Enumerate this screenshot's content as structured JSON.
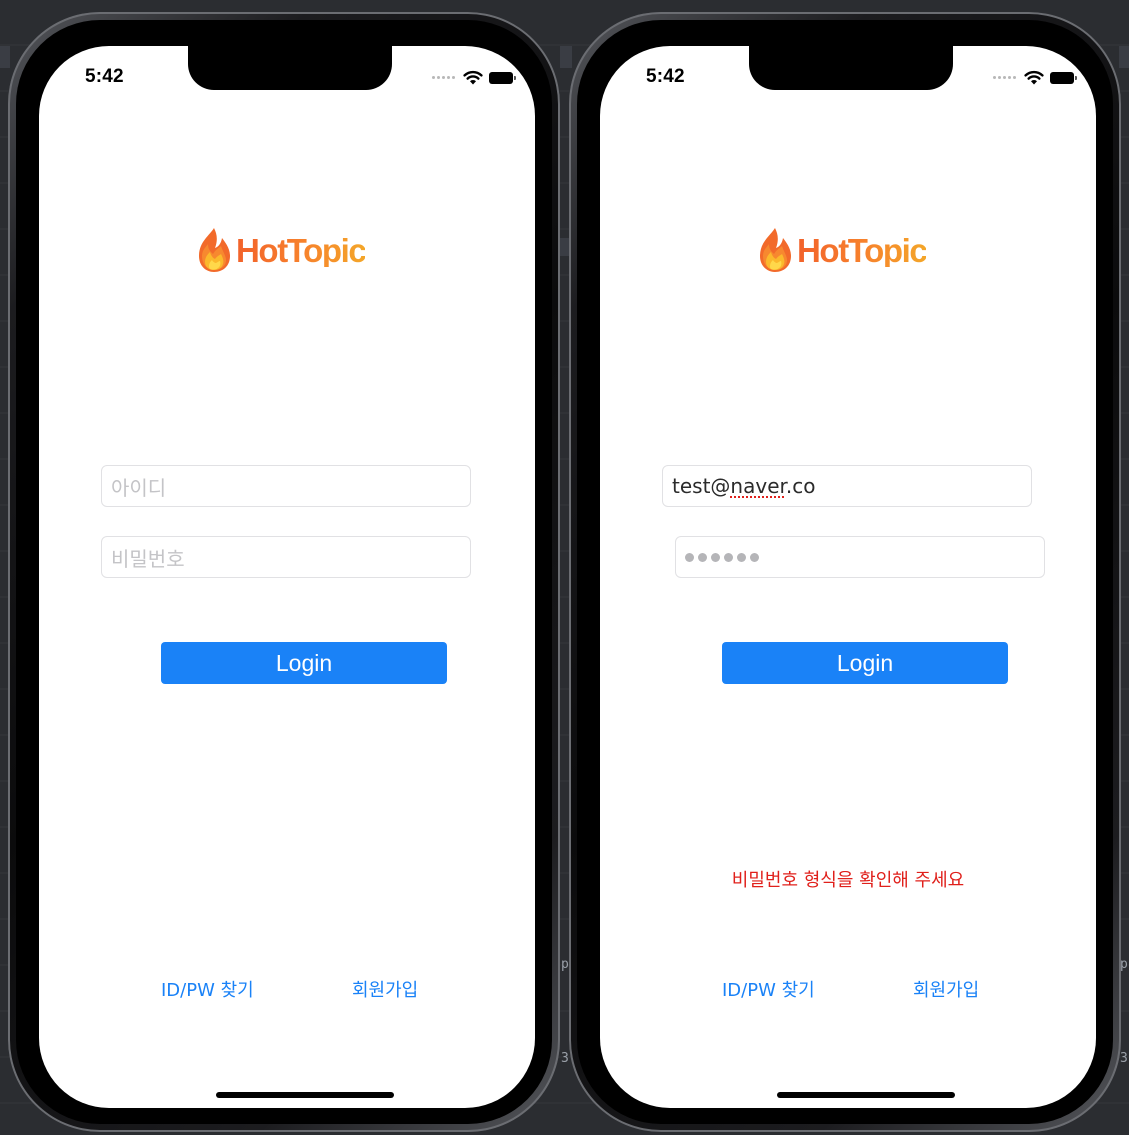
{
  "status_bar": {
    "time": "5:42"
  },
  "app": {
    "logo_text": "HotTopic",
    "brand_gradient": [
      "#f2622b",
      "#f7802c",
      "#f4a629"
    ]
  },
  "screens": {
    "left": {
      "id_field": {
        "placeholder": "아이디",
        "value": ""
      },
      "password_field": {
        "placeholder": "비밀번호",
        "masked_length": 0
      },
      "login_label": "Login",
      "find_link": "ID/PW 찾기",
      "signup_link": "회원가입"
    },
    "right": {
      "id_field": {
        "placeholder": "아이디",
        "value_prefix": "test@",
        "value_misspelled": "naver",
        "value_suffix": ".co"
      },
      "password_field": {
        "placeholder": "비밀번호",
        "masked_length": 6
      },
      "login_label": "Login",
      "error_message": "비밀번호 형식을 확인해 주세요",
      "find_link": "ID/PW 찾기",
      "signup_link": "회원가입"
    }
  },
  "colors": {
    "primary": "#1a82f7",
    "error": "#e0201b"
  }
}
